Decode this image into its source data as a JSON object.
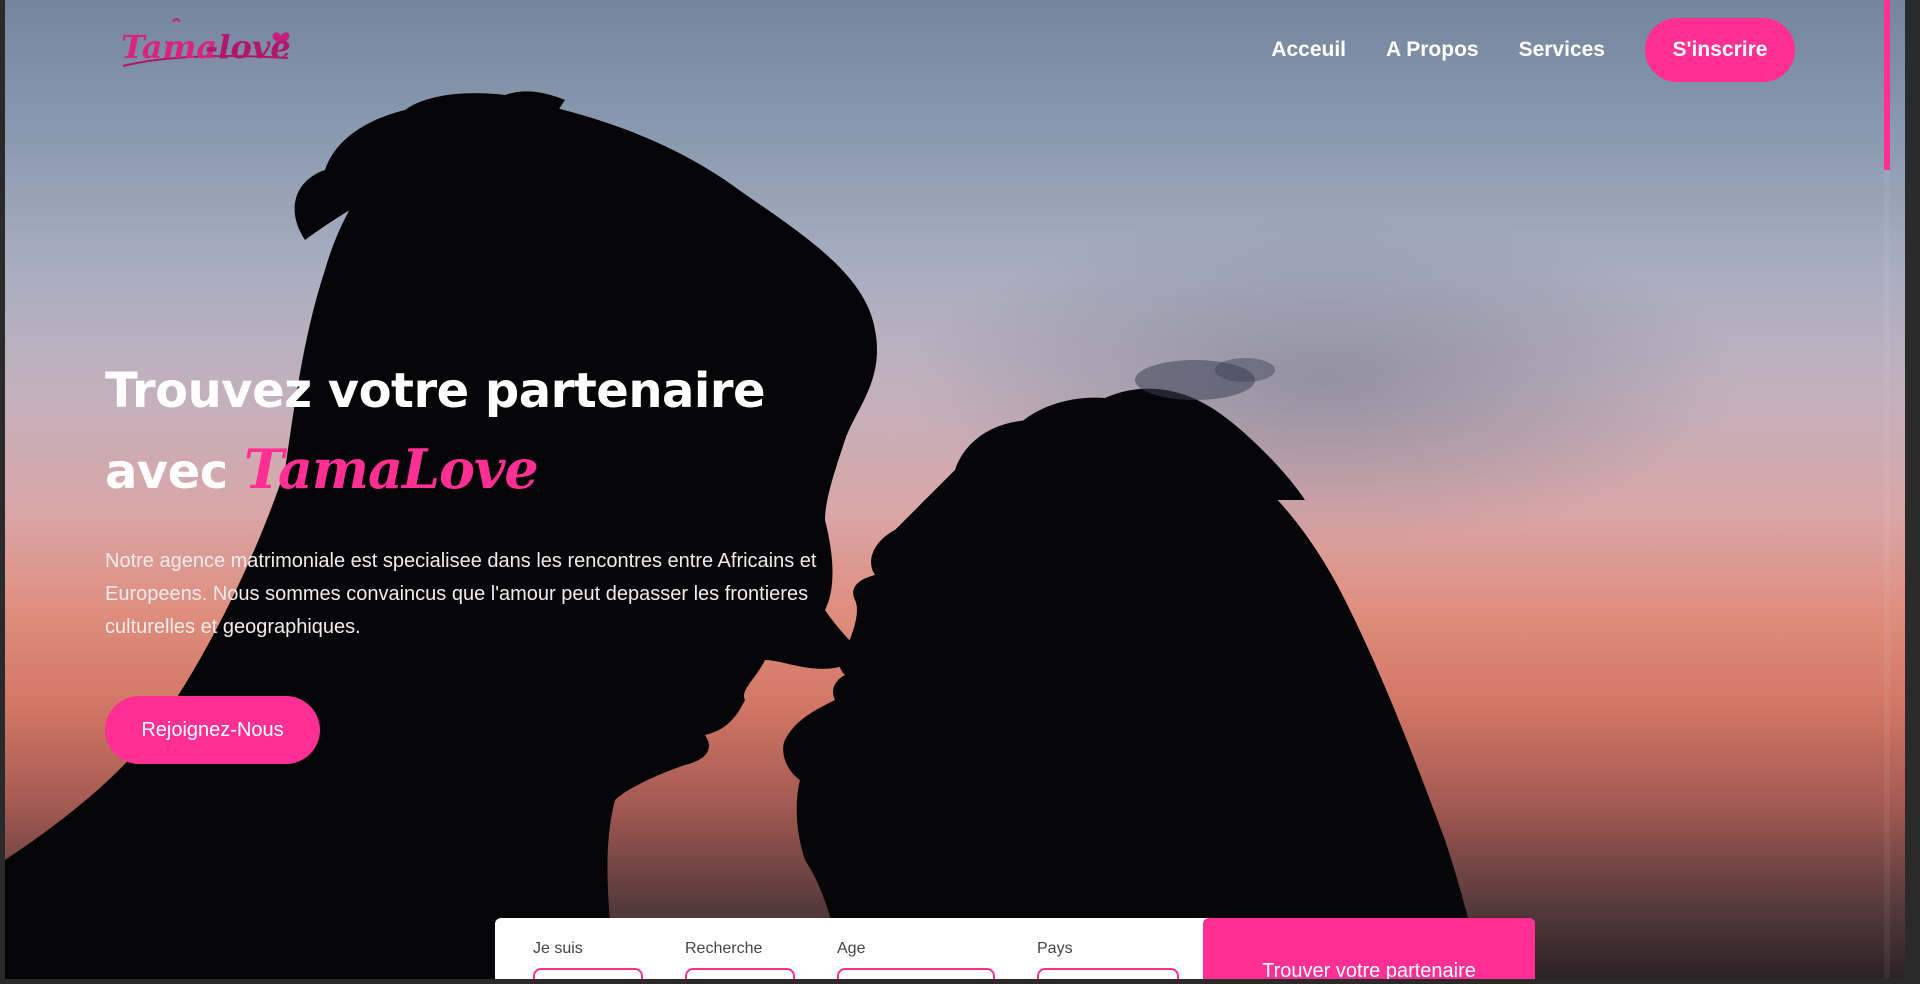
{
  "header": {
    "logo_text": "Tama-love",
    "nav": [
      "Acceuil",
      "A Propos",
      "Services"
    ],
    "cta": "S'inscrire"
  },
  "hero": {
    "title_line1": "Trouvez votre partenaire",
    "title_line2_prefix": "avec",
    "brand": "TamaLove",
    "description": "Notre agence matrimoniale est specialisee dans les rencontres entre Africains et Europeens. Nous sommes convaincus que l'amour peut depasser les frontieres culturelles et geographiques.",
    "cta": "Rejoignez-Nous"
  },
  "search": {
    "fields": [
      "Je suis",
      "Recherche",
      "Age",
      "Pays"
    ],
    "button": "Trouver votre partenaire"
  },
  "colors": {
    "accent": "#ff2f93"
  }
}
